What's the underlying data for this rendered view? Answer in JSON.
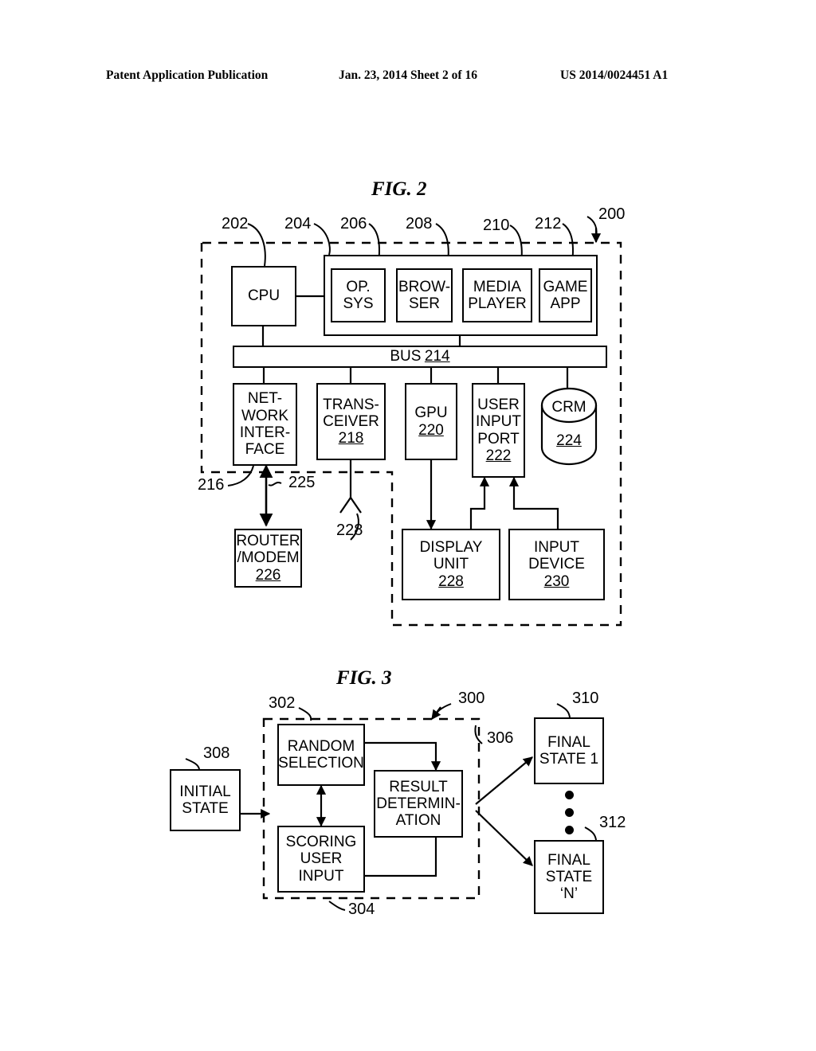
{
  "header": {
    "publication": "Patent Application Publication",
    "date_sheet": "Jan. 23, 2014  Sheet 2 of 16",
    "patent_number": "US 2014/0024451 A1"
  },
  "figures": [
    {
      "id": "fig2",
      "title": "FIG. 2",
      "system_ref": "200",
      "blocks": [
        {
          "key": "cpu",
          "label": "CPU",
          "ref": "202"
        },
        {
          "key": "memory",
          "label": "",
          "ref": "204"
        },
        {
          "key": "opsys",
          "label": "OP.\nSYS",
          "ref": "206"
        },
        {
          "key": "browser",
          "label": "BROW-\nSER",
          "ref": "208"
        },
        {
          "key": "media",
          "label": "MEDIA\nPLAYER",
          "ref": "210"
        },
        {
          "key": "gameapp",
          "label": "GAME\nAPP",
          "ref": "212"
        },
        {
          "key": "bus",
          "label": "BUS",
          "ref": "214"
        },
        {
          "key": "netiface",
          "label": "NET-\nWORK\nINTER-\nFACE",
          "ref": "216"
        },
        {
          "key": "transceiver",
          "label": "TRANS-\nCEIVER",
          "ref": "218"
        },
        {
          "key": "gpu",
          "label": "GPU",
          "ref": "220"
        },
        {
          "key": "userport",
          "label": "USER\nINPUT\nPORT",
          "ref": "222"
        },
        {
          "key": "crm",
          "label": "CRM",
          "ref": "224"
        },
        {
          "key": "link",
          "label": "",
          "ref": "225"
        },
        {
          "key": "router",
          "label": "ROUTER\n/MODEM",
          "ref": "226"
        },
        {
          "key": "antenna",
          "label": "",
          "ref": "228"
        },
        {
          "key": "display",
          "label": "DISPLAY\nUNIT",
          "ref": "228"
        },
        {
          "key": "inputdev",
          "label": "INPUT\nDEVICE",
          "ref": "230"
        }
      ]
    },
    {
      "id": "fig3",
      "title": "FIG. 3",
      "system_ref": "300",
      "blocks": [
        {
          "key": "initial",
          "label": "INITIAL\nSTATE",
          "ref": "308"
        },
        {
          "key": "random",
          "label": "RANDOM\nSELECTION",
          "ref": "302"
        },
        {
          "key": "scoring",
          "label": "SCORING\nUSER\nINPUT",
          "ref": "304"
        },
        {
          "key": "result",
          "label": "RESULT\nDETERMIN-\nATION",
          "ref": "306"
        },
        {
          "key": "final1",
          "label": "FINAL\nSTATE 1",
          "ref": "310"
        },
        {
          "key": "finaln",
          "label": "FINAL\nSTATE\n‘N’",
          "ref": "312"
        }
      ]
    }
  ],
  "fig2": {
    "title": "FIG. 2",
    "cpu": {
      "l1": "CPU"
    },
    "opsys": {
      "l1": "OP.",
      "l2": "SYS"
    },
    "browser": {
      "l1": "BROW-",
      "l2": "SER"
    },
    "media": {
      "l1": "MEDIA",
      "l2": "PLAYER"
    },
    "gameapp": {
      "l1": "GAME",
      "l2": "APP"
    },
    "bus": {
      "l1": "BUS",
      "ref": "214"
    },
    "netiface": {
      "l1": "NET-",
      "l2": "WORK",
      "l3": "INTER-",
      "l4": "FACE"
    },
    "transceiver": {
      "l1": "TRANS-",
      "l2": "CEIVER",
      "ref": "218"
    },
    "gpu": {
      "l1": "GPU",
      "ref": "220"
    },
    "userport": {
      "l1": "USER",
      "l2": "INPUT",
      "l3": "PORT",
      "ref": "222"
    },
    "crm": {
      "l1": "CRM",
      "ref": "224"
    },
    "router": {
      "l1": "ROUTER",
      "l2": "/MODEM",
      "ref": "226"
    },
    "display": {
      "l1": "DISPLAY",
      "l2": "UNIT",
      "ref": "228"
    },
    "inputdev": {
      "l1": "INPUT",
      "l2": "DEVICE",
      "ref": "230"
    },
    "refs": {
      "r200": "200",
      "r202": "202",
      "r204": "204",
      "r206": "206",
      "r208": "208",
      "r210": "210",
      "r212": "212",
      "r216": "216",
      "r225": "225",
      "r228": "228"
    }
  },
  "fig3": {
    "title": "FIG. 3",
    "initial": {
      "l1": "INITIAL",
      "l2": "STATE"
    },
    "random": {
      "l1": "RANDOM",
      "l2": "SELECTION"
    },
    "scoring": {
      "l1": "SCORING",
      "l2": "USER",
      "l3": "INPUT"
    },
    "result": {
      "l1": "RESULT",
      "l2": "DETERMIN-",
      "l3": "ATION"
    },
    "final1": {
      "l1": "FINAL",
      "l2": "STATE 1"
    },
    "finaln": {
      "l1": "FINAL",
      "l2": "STATE",
      "l3": "‘N’"
    },
    "refs": {
      "r300": "300",
      "r302": "302",
      "r304": "304",
      "r306": "306",
      "r308": "308",
      "r310": "310",
      "r312": "312"
    }
  }
}
